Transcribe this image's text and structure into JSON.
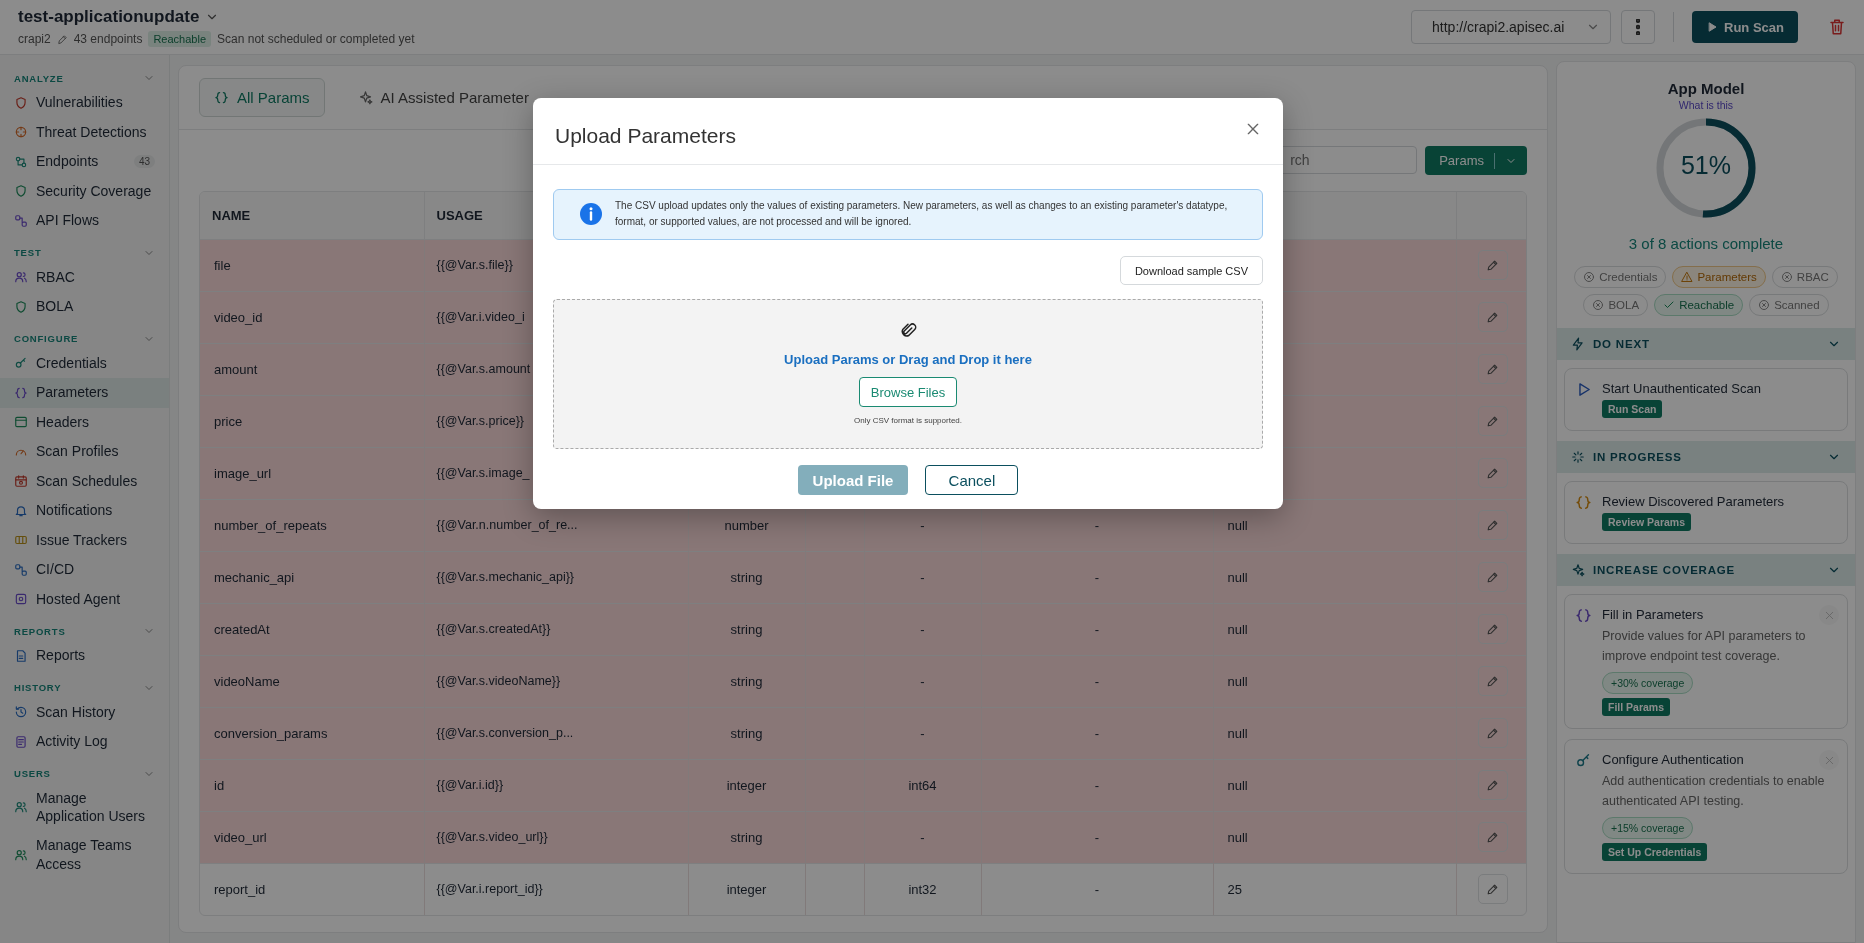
{
  "header": {
    "title": "test-applicationupdate",
    "project": "crapi2",
    "endpoints": "43 endpoints",
    "status_badge": "Reachable",
    "scan_status": "Scan not scheduled or completed yet",
    "url_select": {
      "value": "http://crapi2.apisec.ai"
    },
    "run_button": "Run Scan"
  },
  "sidebar": {
    "sections": [
      {
        "label": "ANALYZE",
        "expanded": true,
        "items": [
          {
            "label": "Vulnerabilities",
            "selected": false
          },
          {
            "label": "Threat Detections",
            "selected": false
          },
          {
            "label": "Endpoints",
            "badge": "43",
            "selected": false
          },
          {
            "label": "Security Coverage",
            "selected": false
          },
          {
            "label": "API Flows",
            "selected": false
          }
        ]
      },
      {
        "label": "TEST",
        "expanded": true,
        "items": [
          {
            "label": "RBAC",
            "selected": false
          },
          {
            "label": "BOLA",
            "selected": false
          }
        ]
      },
      {
        "label": "CONFIGURE",
        "expanded": true,
        "items": [
          {
            "label": "Credentials",
            "selected": false
          },
          {
            "label": "Parameters",
            "selected": true
          },
          {
            "label": "Headers",
            "selected": false
          },
          {
            "label": "Scan Profiles",
            "selected": false
          },
          {
            "label": "Scan Schedules",
            "selected": false
          },
          {
            "label": "Notifications",
            "selected": false
          },
          {
            "label": "Issue Trackers",
            "selected": false
          },
          {
            "label": "CI/CD",
            "selected": false
          },
          {
            "label": "Hosted Agent",
            "selected": false
          }
        ]
      },
      {
        "label": "REPORTS",
        "expanded": true,
        "items": [
          {
            "label": "Reports",
            "selected": false
          }
        ]
      },
      {
        "label": "HISTORY",
        "expanded": true,
        "items": [
          {
            "label": "Scan History",
            "selected": false
          },
          {
            "label": "Activity Log",
            "selected": false
          }
        ]
      },
      {
        "label": "USERS",
        "expanded": true,
        "items": [
          {
            "label": "Manage Application Users",
            "selected": false
          },
          {
            "label": "Manage Teams Access",
            "selected": false
          }
        ]
      }
    ]
  },
  "tabs": [
    {
      "label": "All Params",
      "selected": true
    },
    {
      "label": "AI Assisted Parameter",
      "selected": false
    }
  ],
  "search": {
    "placeholder": "rch"
  },
  "params_button": "Params",
  "table": {
    "columns": [
      "NAME",
      "USAGE"
    ],
    "rows": [
      {
        "name": "file",
        "usage": "{{@Var.s.file}}",
        "missing": true
      },
      {
        "name": "video_id",
        "usage": "{{@Var.i.video_i",
        "missing": true
      },
      {
        "name": "amount",
        "usage": "{{@Var.s.amount",
        "missing": true
      },
      {
        "name": "price",
        "usage": "{{@Var.s.price}}",
        "missing": true
      },
      {
        "name": "image_url",
        "usage": "{{@Var.s.image_",
        "missing": true
      },
      {
        "name": "number_of_repeats",
        "usage": "{{@Var.n.number_of_re...",
        "type": "number",
        "format": "-",
        "column_6": "-",
        "value": "null",
        "missing": true
      },
      {
        "name": "mechanic_api",
        "usage": "{{@Var.s.mechanic_api}}",
        "type": "string",
        "format": "-",
        "column_6": "-",
        "value": "null",
        "missing": true
      },
      {
        "name": "createdAt",
        "usage": "{{@Var.s.createdAt}}",
        "type": "string",
        "format": "-",
        "column_6": "-",
        "value": "null",
        "missing": true
      },
      {
        "name": "videoName",
        "usage": "{{@Var.s.videoName}}",
        "type": "string",
        "format": "-",
        "column_6": "-",
        "value": "null",
        "missing": true
      },
      {
        "name": "conversion_params",
        "usage": "{{@Var.s.conversion_p...",
        "type": "string",
        "format": "-",
        "column_6": "-",
        "value": "null",
        "missing": true
      },
      {
        "name": "id",
        "usage": "{{@Var.i.id}}",
        "type": "integer",
        "format": "int64",
        "column_6": "-",
        "value": "null",
        "missing": true
      },
      {
        "name": "video_url",
        "usage": "{{@Var.s.video_url}}",
        "type": "string",
        "format": "-",
        "column_6": "-",
        "value": "null",
        "missing": true
      },
      {
        "name": "report_id",
        "usage": "{{@Var.i.report_id}}",
        "type": "integer",
        "format": "int32",
        "column_6": "-",
        "value": "25",
        "missing": false
      }
    ]
  },
  "app_model": {
    "title": "App Model",
    "link": "What is this",
    "progress": {
      "level": 0.51,
      "reading": "51%"
    },
    "summary": "3 of 8 actions complete",
    "chips": [
      {
        "label": "Credentials",
        "kind": "missing"
      },
      {
        "label": "Parameters",
        "kind": "warning"
      },
      {
        "label": "RBAC",
        "kind": "missing"
      },
      {
        "label": "BOLA",
        "kind": "missing"
      },
      {
        "label": "Reachable",
        "kind": "done"
      },
      {
        "label": "Scanned",
        "kind": "missing"
      }
    ],
    "sections": [
      {
        "title": "DO NEXT",
        "expanded": true,
        "cards": [
          {
            "title": "Start Unauthenticated Scan",
            "action": "Run Scan",
            "dismissible": false
          }
        ]
      },
      {
        "title": "IN PROGRESS",
        "expanded": true,
        "cards": [
          {
            "title": "Review Discovered Parameters",
            "action": "Review Params",
            "dismissible": false
          }
        ]
      },
      {
        "title": "INCREASE COVERAGE",
        "expanded": true,
        "cards": [
          {
            "title": "Fill in Parameters",
            "description": "Provide values for API parameters to improve endpoint test coverage.",
            "badge": "+30% coverage",
            "action": "Fill Params",
            "dismissible": true
          },
          {
            "title": "Configure Authentication",
            "description": "Add authentication credentials to enable authenticated API testing.",
            "badge": "+15% coverage",
            "action": "Set Up Credentials",
            "dismissible": true
          }
        ]
      }
    ]
  },
  "modal": {
    "title": "Upload Parameters",
    "notice": "The CSV upload updates only the values of existing parameters. New parameters, as well as changes to an existing parameter's datatype, format, or supported values, are not processed and will be ignored.",
    "download_button": "Download sample CSV",
    "dropzone": {
      "prompt": "Upload Params or Drag and Drop it here",
      "browse_button": "Browse Files",
      "hint": "Only CSV format is supported."
    },
    "buttons": [
      {
        "label": "Upload File",
        "kind": "primary",
        "disabled": true
      },
      {
        "label": "Cancel",
        "kind": "secondary",
        "disabled": false
      }
    ]
  }
}
